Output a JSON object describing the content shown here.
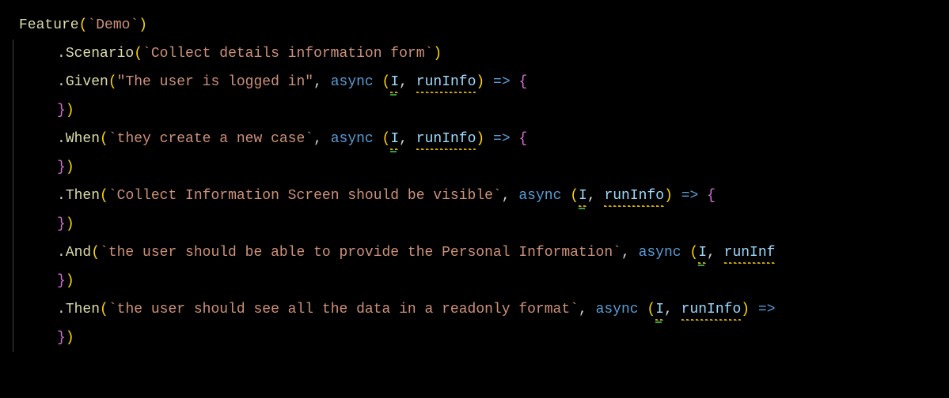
{
  "code": {
    "featureCall": "Feature",
    "featureArg": "`Demo`",
    "lines": [
      {
        "method": "Scenario",
        "arg": "`Collect details information form`",
        "hasCallback": false
      },
      {
        "method": "Given",
        "arg": "\"The user is logged in\"",
        "hasCallback": true,
        "p1": "I",
        "p2": "runInfo"
      },
      {
        "method": "When",
        "arg": "`they create a new case`",
        "hasCallback": true,
        "p1": "I",
        "p2": "runInfo"
      },
      {
        "method": "Then",
        "arg": "`Collect Information Screen should be visible`",
        "hasCallback": true,
        "p1": "I",
        "p2": "runInfo"
      },
      {
        "method": "And",
        "arg": "`the user should be able to provide the Personal Information`",
        "hasCallback": true,
        "p1": "I",
        "p2": "runInf",
        "truncated": true
      },
      {
        "method": "Then",
        "arg": "`the user should see all the data in a readonly format`",
        "hasCallback": true,
        "p1": "I",
        "p2": "runInfo",
        "noBrace": true
      }
    ],
    "asyncKw": "async",
    "arrow": "=>",
    "openBrace": "{",
    "closeBrace": "}",
    "closeParen": ")",
    "openParen": "(",
    "comma": ",",
    "dot": "."
  }
}
